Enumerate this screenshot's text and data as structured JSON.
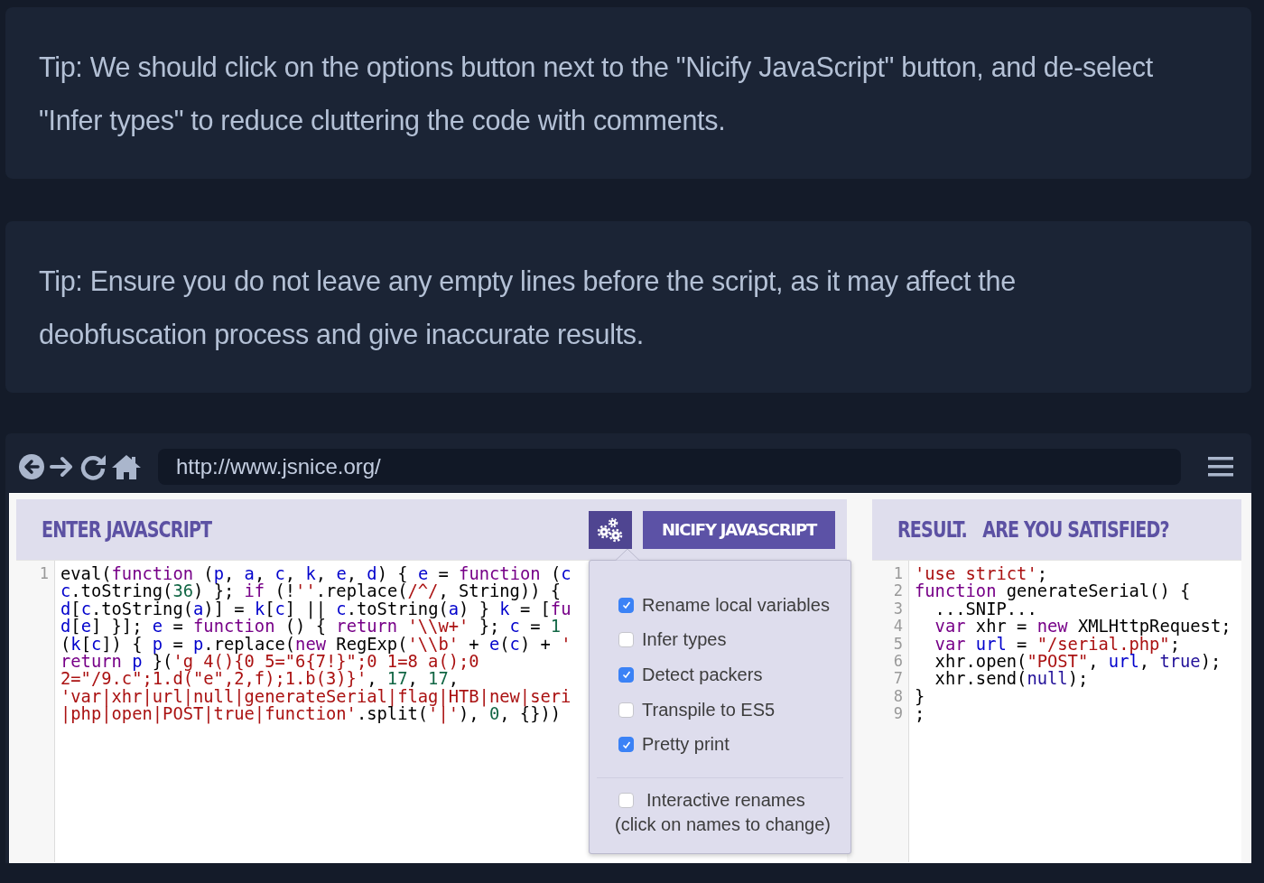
{
  "tips": [
    "Tip: We should click on the options button next to the \"Nicify JavaScript\" button, and de-select \"Infer types\" to reduce cluttering the code with comments.",
    "Tip: Ensure you do not leave any empty lines before the script, as it may affect the deobfuscation process and give inaccurate results."
  ],
  "browser": {
    "url": "http://www.jsnice.org/"
  },
  "input_panel": {
    "title": "ENTER JAVASCRIPT",
    "button": "NICIFY JAVASCRIPT",
    "lines": [
      {
        "number": "1",
        "tokens": [
          {
            "kind": "plain",
            "text": "eval("
          },
          {
            "kind": "keyword",
            "text": "function"
          },
          {
            "kind": "plain",
            "text": " ("
          },
          {
            "kind": "variable",
            "text": "p"
          },
          {
            "kind": "plain",
            "text": ", "
          },
          {
            "kind": "variable",
            "text": "a"
          },
          {
            "kind": "plain",
            "text": ", "
          },
          {
            "kind": "variable",
            "text": "c"
          },
          {
            "kind": "plain",
            "text": ", "
          },
          {
            "kind": "variable",
            "text": "k"
          },
          {
            "kind": "plain",
            "text": ", "
          },
          {
            "kind": "variable",
            "text": "e"
          },
          {
            "kind": "plain",
            "text": ", "
          },
          {
            "kind": "variable",
            "text": "d"
          },
          {
            "kind": "plain",
            "text": ") { "
          },
          {
            "kind": "variable",
            "text": "e"
          },
          {
            "kind": "plain",
            "text": " = "
          },
          {
            "kind": "keyword",
            "text": "function"
          },
          {
            "kind": "plain",
            "text": " ("
          },
          {
            "kind": "variable",
            "text": "c"
          }
        ]
      },
      {
        "tokens": [
          {
            "kind": "variable",
            "text": "c"
          },
          {
            "kind": "plain",
            "text": ".toString("
          },
          {
            "kind": "number",
            "text": "36"
          },
          {
            "kind": "plain",
            "text": ") }; "
          },
          {
            "kind": "keyword",
            "text": "if"
          },
          {
            "kind": "plain",
            "text": " (!"
          },
          {
            "kind": "string",
            "text": "''"
          },
          {
            "kind": "plain",
            "text": ".replace("
          },
          {
            "kind": "string",
            "text": "/^/"
          },
          {
            "kind": "plain",
            "text": ", String)) {"
          }
        ]
      },
      {
        "tokens": [
          {
            "kind": "variable",
            "text": "d"
          },
          {
            "kind": "plain",
            "text": "["
          },
          {
            "kind": "variable",
            "text": "c"
          },
          {
            "kind": "plain",
            "text": ".toString("
          },
          {
            "kind": "variable",
            "text": "a"
          },
          {
            "kind": "plain",
            "text": ")] = "
          },
          {
            "kind": "variable",
            "text": "k"
          },
          {
            "kind": "plain",
            "text": "["
          },
          {
            "kind": "variable",
            "text": "c"
          },
          {
            "kind": "plain",
            "text": "] || "
          },
          {
            "kind": "variable",
            "text": "c"
          },
          {
            "kind": "plain",
            "text": ".toString("
          },
          {
            "kind": "variable",
            "text": "a"
          },
          {
            "kind": "plain",
            "text": ") } "
          },
          {
            "kind": "variable",
            "text": "k"
          },
          {
            "kind": "plain",
            "text": " = ["
          },
          {
            "kind": "keyword",
            "text": "fu"
          }
        ]
      },
      {
        "tokens": [
          {
            "kind": "variable",
            "text": "d"
          },
          {
            "kind": "plain",
            "text": "["
          },
          {
            "kind": "variable",
            "text": "e"
          },
          {
            "kind": "plain",
            "text": "] }]; "
          },
          {
            "kind": "variable",
            "text": "e"
          },
          {
            "kind": "plain",
            "text": " = "
          },
          {
            "kind": "keyword",
            "text": "function"
          },
          {
            "kind": "plain",
            "text": " () { "
          },
          {
            "kind": "keyword",
            "text": "return "
          },
          {
            "kind": "string",
            "text": "'\\\\w+'"
          },
          {
            "kind": "plain",
            "text": " }; "
          },
          {
            "kind": "variable",
            "text": "c"
          },
          {
            "kind": "plain",
            "text": " = "
          },
          {
            "kind": "number",
            "text": "1"
          }
        ]
      },
      {
        "tokens": [
          {
            "kind": "plain",
            "text": "("
          },
          {
            "kind": "variable",
            "text": "k"
          },
          {
            "kind": "plain",
            "text": "["
          },
          {
            "kind": "variable",
            "text": "c"
          },
          {
            "kind": "plain",
            "text": "]) { "
          },
          {
            "kind": "variable",
            "text": "p"
          },
          {
            "kind": "plain",
            "text": " = "
          },
          {
            "kind": "variable",
            "text": "p"
          },
          {
            "kind": "plain",
            "text": ".replace("
          },
          {
            "kind": "keyword",
            "text": "new"
          },
          {
            "kind": "plain",
            "text": " RegExp("
          },
          {
            "kind": "string",
            "text": "'\\\\b'"
          },
          {
            "kind": "plain",
            "text": " + "
          },
          {
            "kind": "variable",
            "text": "e"
          },
          {
            "kind": "plain",
            "text": "("
          },
          {
            "kind": "variable",
            "text": "c"
          },
          {
            "kind": "plain",
            "text": ") + "
          },
          {
            "kind": "string",
            "text": "'"
          }
        ]
      },
      {
        "tokens": [
          {
            "kind": "keyword",
            "text": "return "
          },
          {
            "kind": "variable",
            "text": "p"
          },
          {
            "kind": "plain",
            "text": " }("
          },
          {
            "kind": "string",
            "text": "'g 4(){0 5=\"6{7!}\";0 1=8 a();0"
          }
        ]
      },
      {
        "tokens": [
          {
            "kind": "string",
            "text": "2=\"/9.c\";1.d(\"e\",2,f);1.b(3)}'"
          },
          {
            "kind": "plain",
            "text": ", "
          },
          {
            "kind": "number",
            "text": "17"
          },
          {
            "kind": "plain",
            "text": ", "
          },
          {
            "kind": "number",
            "text": "17"
          },
          {
            "kind": "plain",
            "text": ","
          }
        ]
      },
      {
        "tokens": [
          {
            "kind": "string",
            "text": "'var|xhr|url|null|generateSerial|flag|HTB|new|seri"
          }
        ]
      },
      {
        "tokens": [
          {
            "kind": "string",
            "text": "|php|open|POST|true|function'"
          },
          {
            "kind": "plain",
            "text": ".split("
          },
          {
            "kind": "string",
            "text": "'|'"
          },
          {
            "kind": "plain",
            "text": "), "
          },
          {
            "kind": "number",
            "text": "0"
          },
          {
            "kind": "plain",
            "text": ", {}))"
          }
        ]
      }
    ]
  },
  "options": {
    "items": [
      {
        "label": "Rename local variables",
        "checked": true
      },
      {
        "label": "Infer types",
        "checked": false
      },
      {
        "label": "Detect packers",
        "checked": true
      },
      {
        "label": "Transpile to ES5",
        "checked": false
      },
      {
        "label": "Pretty print",
        "checked": true
      }
    ],
    "interactive": {
      "label": "Interactive renames",
      "note": "(click on names to change)",
      "checked": false
    }
  },
  "result_panel": {
    "title": "RESULT.   ARE YOU SATISFIED?",
    "lines": [
      {
        "number": "1",
        "tokens": [
          {
            "kind": "string",
            "text": "'use strict'"
          },
          {
            "kind": "plain",
            "text": ";"
          }
        ]
      },
      {
        "number": "2",
        "tokens": [
          {
            "kind": "keyword",
            "text": "function"
          },
          {
            "kind": "plain",
            "text": " generateSerial() {"
          }
        ]
      },
      {
        "number": "3",
        "tokens": [
          {
            "kind": "plain",
            "text": "  ...SNIP..."
          }
        ]
      },
      {
        "number": "4",
        "tokens": [
          {
            "kind": "keyword",
            "text": "  var"
          },
          {
            "kind": "plain",
            "text": " xhr = "
          },
          {
            "kind": "keyword",
            "text": "new"
          },
          {
            "kind": "plain",
            "text": " XMLHttpRequest;"
          }
        ]
      },
      {
        "number": "5",
        "tokens": [
          {
            "kind": "keyword",
            "text": "  var "
          },
          {
            "kind": "variable",
            "text": "url"
          },
          {
            "kind": "plain",
            "text": " = "
          },
          {
            "kind": "string",
            "text": "\"/serial.php\""
          },
          {
            "kind": "plain",
            "text": ";"
          }
        ]
      },
      {
        "number": "6",
        "tokens": [
          {
            "kind": "plain",
            "text": "  xhr.open("
          },
          {
            "kind": "string",
            "text": "\"POST\""
          },
          {
            "kind": "plain",
            "text": ", "
          },
          {
            "kind": "variable",
            "text": "url"
          },
          {
            "kind": "plain",
            "text": ", "
          },
          {
            "kind": "atom",
            "text": "true"
          },
          {
            "kind": "plain",
            "text": ");"
          }
        ]
      },
      {
        "number": "7",
        "tokens": [
          {
            "kind": "plain",
            "text": "  xhr.send("
          },
          {
            "kind": "atom",
            "text": "null"
          },
          {
            "kind": "plain",
            "text": ");"
          }
        ]
      },
      {
        "number": "8",
        "tokens": [
          {
            "kind": "plain",
            "text": "}"
          }
        ]
      },
      {
        "number": "9",
        "tokens": [
          {
            "kind": "plain",
            "text": ";"
          }
        ]
      }
    ]
  }
}
